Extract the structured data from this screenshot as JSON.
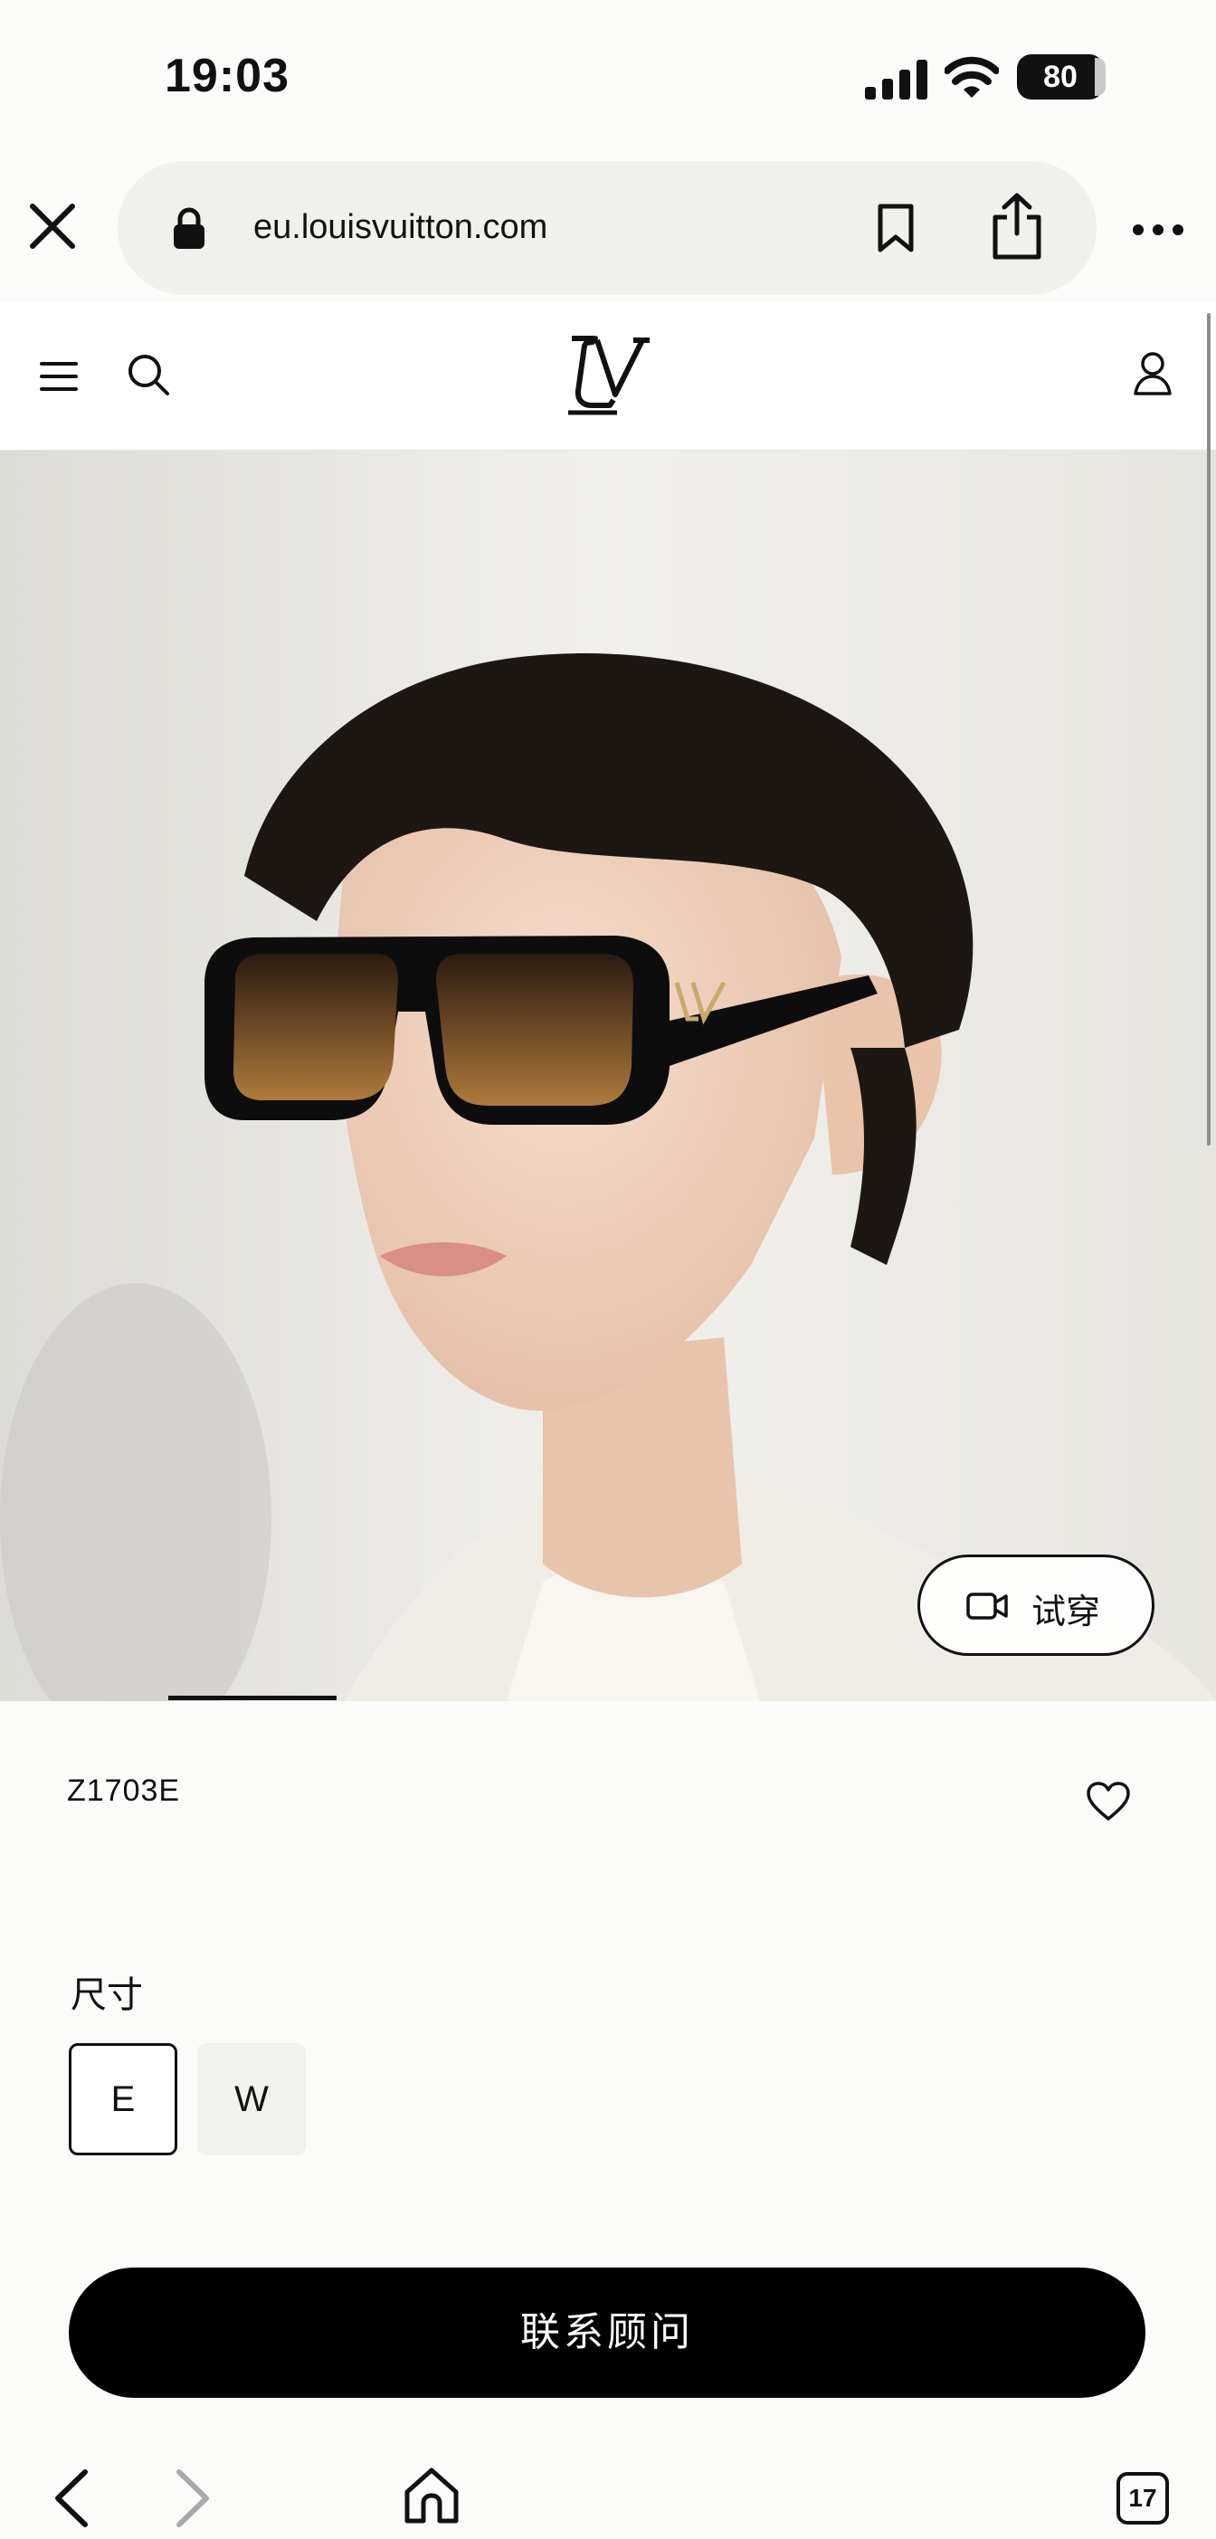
{
  "status_bar": {
    "time": "19:03",
    "battery": "80",
    "icons": [
      "signal-icon",
      "wifi-icon",
      "battery-icon"
    ]
  },
  "browser": {
    "url": "eu.louisvuitton.com",
    "icons": [
      "close-icon",
      "lock-icon",
      "bookmark-icon",
      "share-icon",
      "more-icon"
    ]
  },
  "site_nav": {
    "icons": [
      "menu-icon",
      "search-icon",
      "lv-logo",
      "account-icon"
    ]
  },
  "product": {
    "code": "Z1703E",
    "try_on_label": "试穿",
    "size_label": "尺寸",
    "sizes": [
      {
        "label": "E",
        "selected": true
      },
      {
        "label": "W",
        "selected": false
      }
    ],
    "contact_label": "联系顾问"
  },
  "toolbar": {
    "tabs_count": "17",
    "icons": [
      "back-icon",
      "forward-icon",
      "home-icon",
      "tabs-icon"
    ]
  },
  "colors": {
    "accent": "#000000",
    "background": "#fbfbf9",
    "url_bar": "#f0f1ed",
    "lens_gold": "#c9a96a"
  }
}
